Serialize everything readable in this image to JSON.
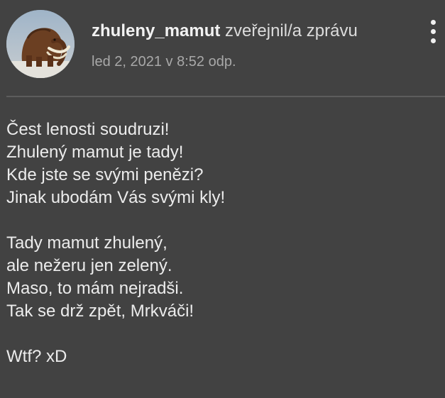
{
  "post": {
    "author": "zhuleny_mamut",
    "action": "zveřejnil/a zprávu",
    "timestamp": "led 2, 2021 v 8:52 odp.",
    "avatar_icon": "mammoth-avatar-icon",
    "menu_icon": "more-vertical-icon",
    "message": {
      "stanzas": [
        {
          "lines": [
            "Čest lenosti soudruzi!",
            "Zhulený mamut je tady!",
            "Kde jste se svými penězi?",
            "Jinak ubodám Vás svými kly!"
          ]
        },
        {
          "lines": [
            "Tady mamut zhulený,",
            "ale nežeru jen zelený.",
            "Maso, to mám nejradši.",
            "Tak se drž zpět, Mrkváči!"
          ]
        },
        {
          "lines": [
            "Wtf? xD"
          ]
        }
      ]
    }
  },
  "colors": {
    "background": "#424242",
    "text": "#ececec",
    "muted": "#a8a8a8",
    "divider": "#5c5c5c"
  }
}
